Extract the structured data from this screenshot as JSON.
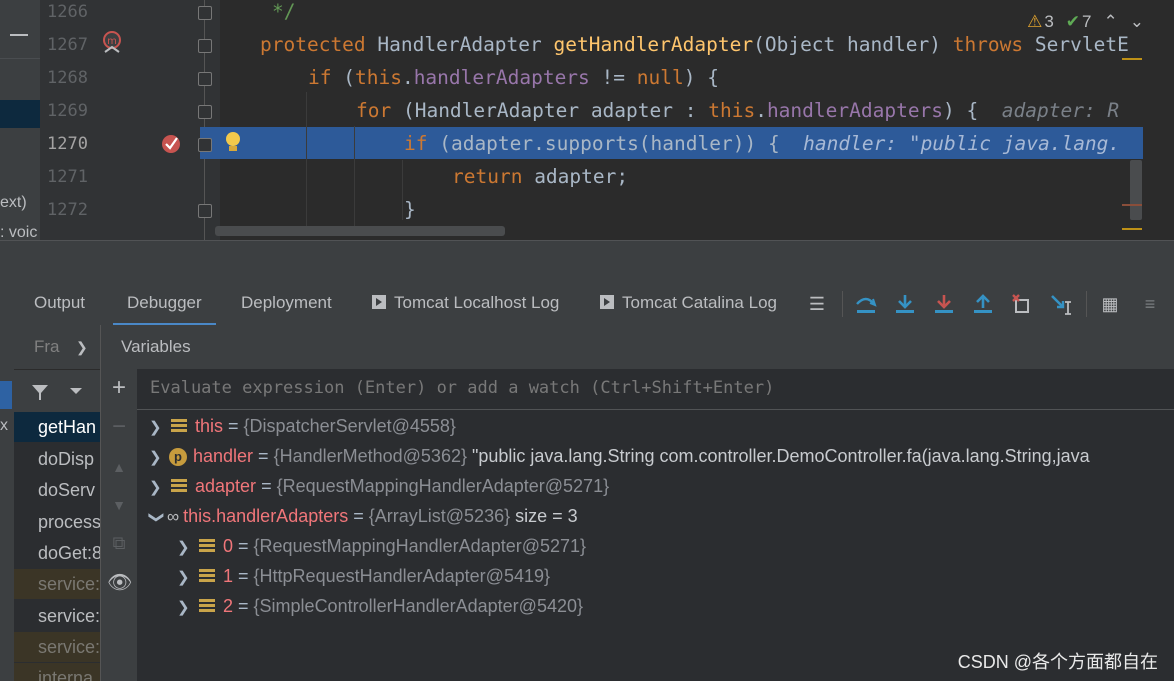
{
  "editor": {
    "inspection": {
      "warnings": "3",
      "ok": "7"
    },
    "left_fragments": [
      "ext)",
      ": voic"
    ],
    "lines": [
      {
        "num": "1266"
      },
      {
        "num": "1267"
      },
      {
        "num": "1268"
      },
      {
        "num": "1269"
      },
      {
        "num": "1270"
      },
      {
        "num": "1271"
      },
      {
        "num": "1272"
      }
    ],
    "code": {
      "l1266": "*/",
      "l1267_kw": "protected",
      "l1267_type": " HandlerAdapter ",
      "l1267_fn": "getHandlerAdapter",
      "l1267_rest": "(Object handler) ",
      "l1267_throws": "throws",
      "l1267_tail": " ServletE",
      "l1268_kw": "if",
      "l1268_a": " (",
      "l1268_this": "this",
      "l1268_dot": ".",
      "l1268_fld": "handlerAdapters",
      "l1268_b": " != ",
      "l1268_null": "null",
      "l1268_c": ") {",
      "l1269_kw": "for",
      "l1269_a": " (HandlerAdapter adapter : ",
      "l1269_this": "this",
      "l1269_dot": ".",
      "l1269_fld": "handlerAdapters",
      "l1269_c": ") {",
      "l1269_hint": "adapter: R",
      "l1270_kw": "if",
      "l1270_a": " (adapter.supports(handler)) {",
      "l1270_hint": "handler: \"public java.lang.",
      "l1271_kw": "return",
      "l1271_a": " adapter;",
      "l1272": "}"
    }
  },
  "tabs": {
    "output": "Output",
    "debugger": "Debugger",
    "deployment": "Deployment",
    "tomcat_localhost": "Tomcat Localhost Log",
    "tomcat_catalina": "Tomcat Catalina Log"
  },
  "frames": {
    "header": "Fra",
    "items": [
      {
        "label": "getHan",
        "state": "selected"
      },
      {
        "label": "doDisp",
        "state": "normal"
      },
      {
        "label": "doServ",
        "state": "normal"
      },
      {
        "label": "process",
        "state": "normal"
      },
      {
        "label": "doGet:8",
        "state": "normal"
      },
      {
        "label": "service:",
        "state": "library"
      },
      {
        "label": "service:",
        "state": "normal"
      },
      {
        "label": "service:",
        "state": "library"
      },
      {
        "label": "interna",
        "state": "library"
      }
    ],
    "left_marker": "x"
  },
  "variables": {
    "header": "Variables",
    "eval_placeholder": "Evaluate expression (Enter) or add a watch (Ctrl+Shift+Enter)",
    "rows": [
      {
        "name": "this",
        "eq": " = ",
        "value": "{DispatcherServlet@4558}",
        "extra": ""
      },
      {
        "name": "handler",
        "eq": " = ",
        "value": "{HandlerMethod@5362}",
        "extra": " \"public java.lang.String com.controller.DemoController.fa(java.lang.String,java"
      },
      {
        "name": "adapter",
        "eq": " = ",
        "value": "{RequestMappingHandlerAdapter@5271}",
        "extra": ""
      },
      {
        "name": "this.handlerAdapters",
        "eq": " = ",
        "value": "{ArrayList@5236}",
        "extra": "  size = 3"
      },
      {
        "name": "0",
        "eq": " = ",
        "value": "{RequestMappingHandlerAdapter@5271}",
        "extra": ""
      },
      {
        "name": "1",
        "eq": " = ",
        "value": "{HttpRequestHandlerAdapter@5419}",
        "extra": ""
      },
      {
        "name": "2",
        "eq": " = ",
        "value": "{SimpleControllerHandlerAdapter@5420}",
        "extra": ""
      }
    ]
  },
  "watermark": "CSDN @各个方面都自在",
  "icons": {
    "warning": "warning-icon",
    "check": "check-icon",
    "up": "chevron-up-icon",
    "down": "chevron-down-icon",
    "breakpoint": "breakpoint-icon",
    "bulb": "bulb-icon",
    "method_bp": "method-breakpoint-icon"
  }
}
